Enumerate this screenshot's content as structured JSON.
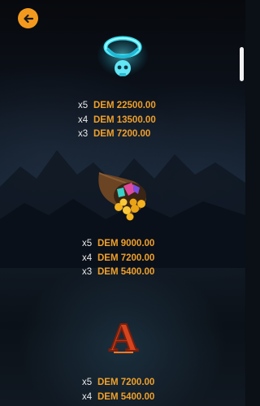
{
  "colors": {
    "accent": "#f39a1e",
    "amount": "#f0a029",
    "multiplier": "#e8e8e8"
  },
  "header": {
    "back_icon": "arrow-left-icon"
  },
  "symbols": [
    {
      "icon": "skull-ring-icon",
      "payouts": [
        {
          "multiplier": "x5",
          "amount": "DEM 22500.00"
        },
        {
          "multiplier": "x4",
          "amount": "DEM 13500.00"
        },
        {
          "multiplier": "x3",
          "amount": "DEM 7200.00"
        }
      ]
    },
    {
      "icon": "treasure-cornucopia-icon",
      "payouts": [
        {
          "multiplier": "x5",
          "amount": "DEM 9000.00"
        },
        {
          "multiplier": "x4",
          "amount": "DEM 7200.00"
        },
        {
          "multiplier": "x3",
          "amount": "DEM 5400.00"
        }
      ]
    },
    {
      "icon": "letter-a-icon",
      "letter": "A",
      "payouts": [
        {
          "multiplier": "x5",
          "amount": "DEM 7200.00"
        },
        {
          "multiplier": "x4",
          "amount": "DEM 5400.00"
        }
      ]
    }
  ]
}
